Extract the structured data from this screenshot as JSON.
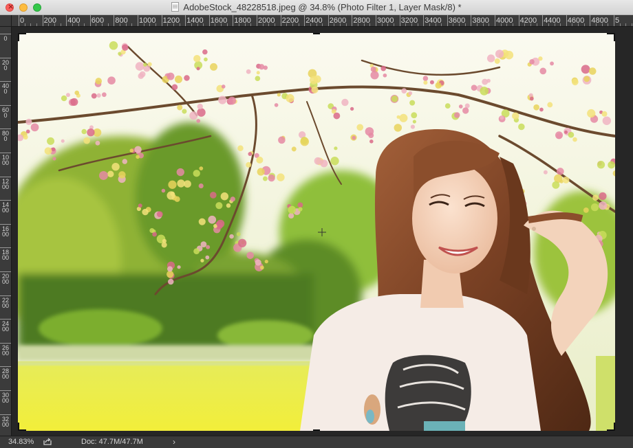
{
  "window": {
    "file_name": "AdobeStock_48228518.jpeg",
    "title_suffix": " @ 34.8% (Photo Filter 1, Layer Mask/8) *"
  },
  "ruler_h": [
    "0",
    "200",
    "400",
    "600",
    "800",
    "1000",
    "1200",
    "1400",
    "1600",
    "1800",
    "2000",
    "2200",
    "2400",
    "2600",
    "2800",
    "3000",
    "3200",
    "3400",
    "3600",
    "3800",
    "4000",
    "4200",
    "4400",
    "4600",
    "4800",
    "5"
  ],
  "ruler_v": [
    "0",
    "2 0 0",
    "4 0 0",
    "6 0 0",
    "8 0 0",
    "1 0 0 0",
    "1 2 0 0",
    "1 4 0 0",
    "1 6 0 0",
    "1 8 0 0",
    "2 0 0 0",
    "2 2 0 0",
    "2 4 0 0",
    "2 6 0 0",
    "2 8 0 0",
    "3 0 0 0",
    "3 2 0 0"
  ],
  "status": {
    "zoom": "34.83%",
    "doc_info": "Doc: 47.7M/47.7M",
    "menu_arrow": "›"
  },
  "icons": {
    "close": "close-icon",
    "minimize": "minimize-icon",
    "maximize": "maximize-icon",
    "document": "document-icon",
    "share": "share-icon",
    "cursor": "crosshair-cursor-icon"
  },
  "colors": {
    "titlebar": "#dcdcdc",
    "ruler": "#3b3b3b",
    "canvas_bg": "#262626",
    "statusbar": "#3a3a3a"
  }
}
